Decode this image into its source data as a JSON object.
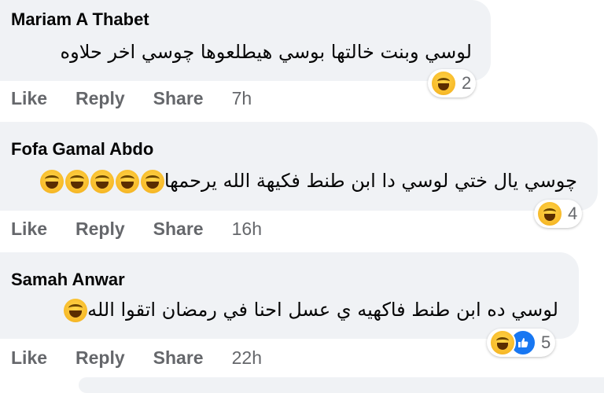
{
  "comments": [
    {
      "author": "Mariam A Thabet",
      "text": "لوسي وبنت خالتها بوسي هيطلعوها چوسي اخر حلاوه",
      "emoji_count": 0,
      "reaction_count": "2",
      "reactions": [
        "haha-icon"
      ],
      "actions": [
        "Like",
        "Reply",
        "Share"
      ],
      "time": "7h"
    },
    {
      "author": "Fofa Gamal Abdo",
      "text": "چوسي يال ختي لوسي دا ابن طنط فكيهة الله يرحمها",
      "emoji_count": 5,
      "reaction_count": "4",
      "reactions": [
        "haha-icon"
      ],
      "actions": [
        "Like",
        "Reply",
        "Share"
      ],
      "time": "16h"
    },
    {
      "author": "Samah Anwar",
      "text": "لوسي ده ابن طنط فاكهيه ي عسل احنا في رمضان اتقوا الله",
      "emoji_count": 1,
      "reaction_count": "5",
      "reactions": [
        "haha-icon",
        "like-icon"
      ],
      "actions": [
        "Like",
        "Reply",
        "Share"
      ],
      "time": "22h"
    }
  ],
  "colors": {
    "bubble": "#f0f2f5",
    "secondary_text": "#65676b",
    "like_blue": "#1877f2",
    "haha_yellow": "#f7b928"
  }
}
